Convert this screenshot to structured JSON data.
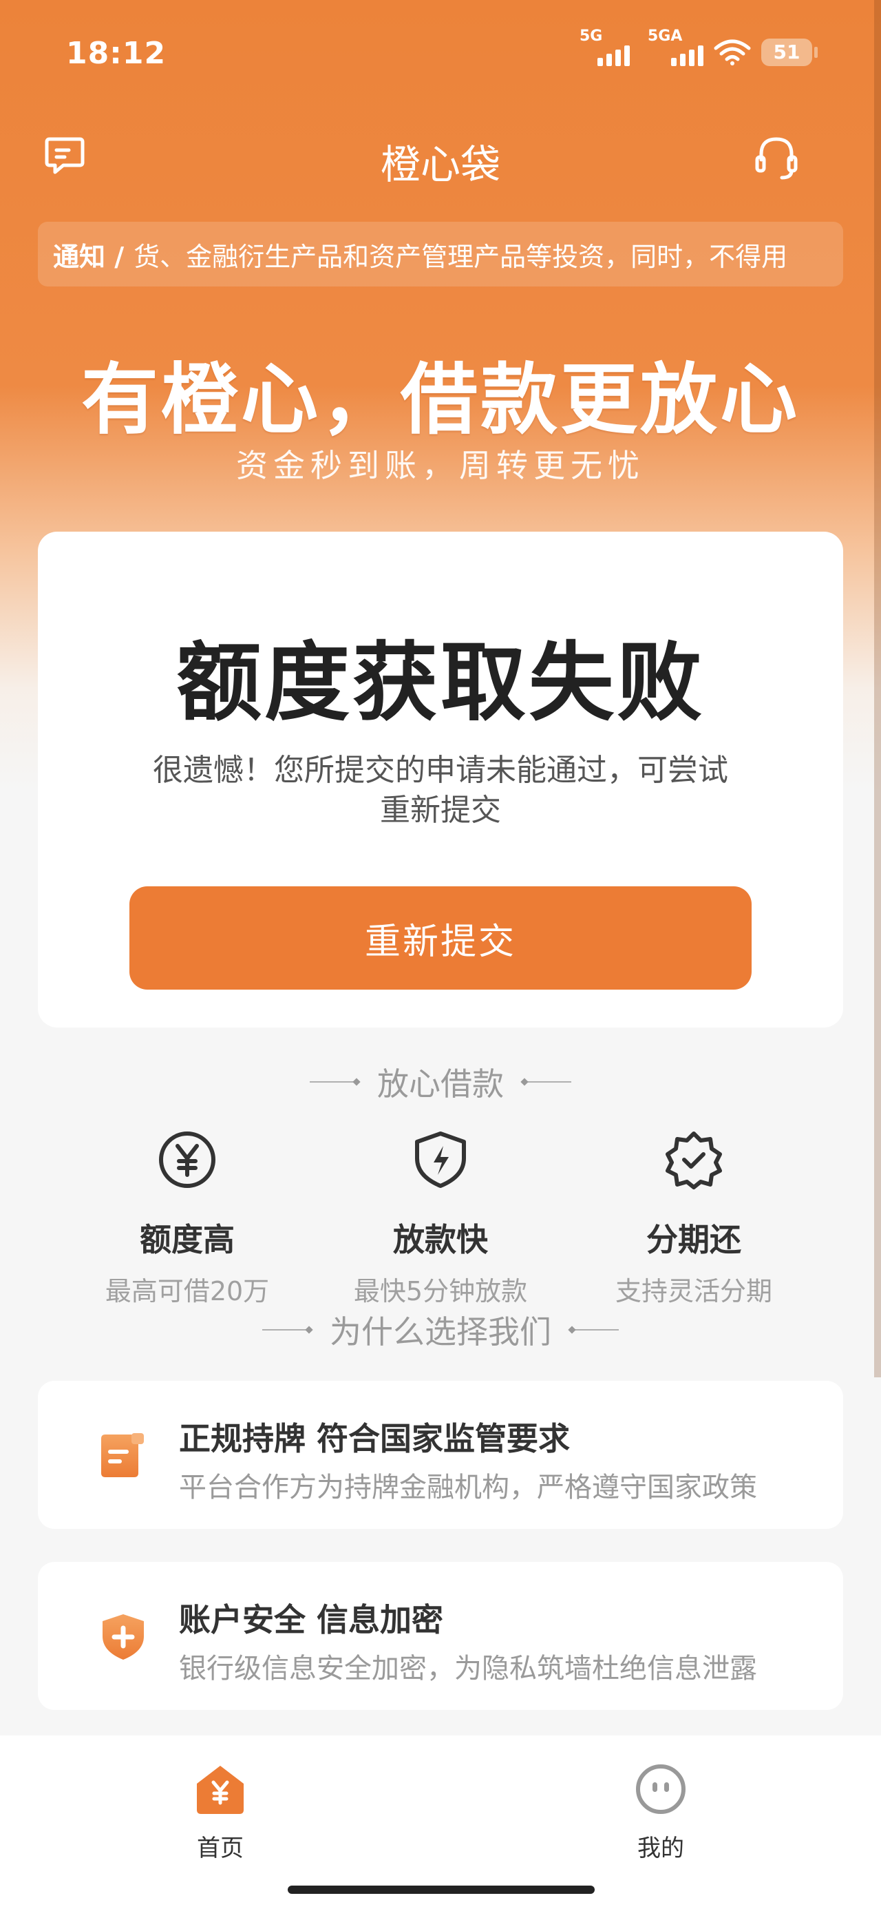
{
  "status_bar": {
    "time": "18:12",
    "signal_1_label": "5G",
    "signal_2_label": "5GA",
    "battery": "51"
  },
  "header": {
    "title": "橙心袋"
  },
  "notice": {
    "label": "通知 /",
    "text": "货、金融衍生产品和资产管理产品等投资，同时，不得用"
  },
  "hero": {
    "title": "有橙心，借款更放心",
    "subtitle": "资金秒到账，周转更无忧"
  },
  "result": {
    "title": "额度获取失败",
    "description": "很遗憾！您所提交的申请未能通过，可尝试重新提交",
    "button_label": "重新提交"
  },
  "features_section": {
    "heading": "放心借款",
    "items": [
      {
        "icon": "yen-circle-icon",
        "title": "额度高",
        "desc": "最高可借20万"
      },
      {
        "icon": "lightning-shield-icon",
        "title": "放款快",
        "desc": "最快5分钟放款"
      },
      {
        "icon": "check-badge-icon",
        "title": "分期还",
        "desc": "支持灵活分期"
      }
    ]
  },
  "why_section": {
    "heading": "为什么选择我们",
    "items": [
      {
        "icon": "license-card-icon",
        "title": "正规持牌 符合国家监管要求",
        "desc": "平台合作方为持牌金融机构，严格遵守国家政策"
      },
      {
        "icon": "security-shield-icon",
        "title": "账户安全 信息加密",
        "desc": "银行级信息安全加密，为隐私筑墙杜绝信息泄露"
      }
    ]
  },
  "tab_bar": {
    "items": [
      {
        "icon": "home-yen-icon",
        "label": "首页"
      },
      {
        "icon": "profile-face-icon",
        "label": "我的"
      }
    ]
  },
  "colors": {
    "brand_orange": "#ec7c35",
    "header_orange": "#ec833a"
  }
}
